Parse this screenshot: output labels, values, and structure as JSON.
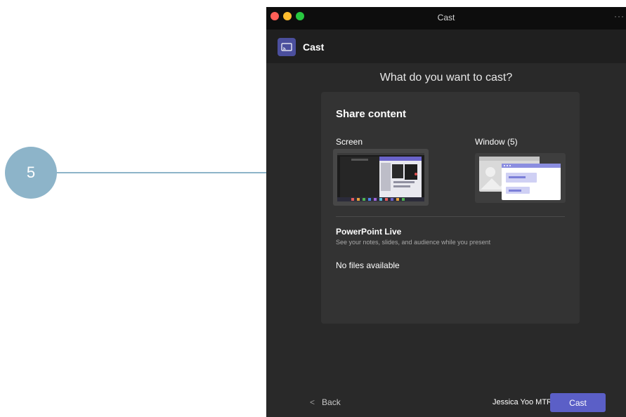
{
  "callout": {
    "number": "5"
  },
  "window": {
    "title": "Cast",
    "more_menu": "···"
  },
  "header": {
    "title": "Cast",
    "icon": "cast-icon"
  },
  "main": {
    "question": "What do you want to cast?",
    "share_content": {
      "title": "Share content",
      "screen_label": "Screen",
      "window_label": "Window (5)"
    },
    "powerpoint": {
      "title": "PowerPoint Live",
      "description": "See your notes, slides, and audience while you present",
      "empty_text": "No files available"
    }
  },
  "footer": {
    "back_label": "Back",
    "back_icon": "chevron-left-icon",
    "device_name": "Jessica Yoo MTR",
    "cast_label": "Cast"
  },
  "colors": {
    "accent": "#5b5fc7",
    "callout": "#8db4c9",
    "window_bg": "#292929",
    "panel_bg": "#333333"
  }
}
